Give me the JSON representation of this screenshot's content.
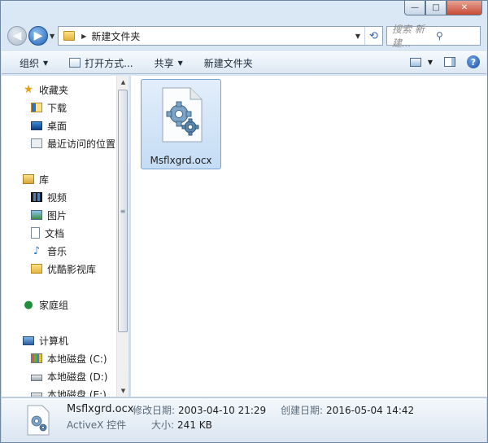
{
  "window": {
    "caption_buttons": {
      "minimize": "—",
      "maximize": "□",
      "close": "✕"
    }
  },
  "address": {
    "path": "新建文件夹",
    "search_placeholder": "搜索 新建..."
  },
  "toolbar": {
    "organize": "组织",
    "open_with": "打开方式...",
    "share": "共享",
    "new_folder": "新建文件夹"
  },
  "nav": {
    "favorites": "收藏夹",
    "downloads": "下载",
    "desktop": "桌面",
    "recent": "最近访问的位置",
    "libraries": "库",
    "videos": "视频",
    "pictures": "图片",
    "documents": "文档",
    "music": "音乐",
    "youku": "优酷影视库",
    "homegroup": "家庭组",
    "computer": "计算机",
    "drive_c": "本地磁盘 (C:)",
    "drive_d": "本地磁盘 (D:)",
    "drive_e": "本地磁盘 (E:)"
  },
  "file": {
    "name": "Msflxgrd.ocx"
  },
  "details": {
    "name": "Msflxgrd.ocx",
    "type": "ActiveX 控件",
    "modified_label": "修改日期:",
    "modified_value": "2003-04-10 21:29",
    "created_label": "创建日期:",
    "created_value": "2016-05-04 14:42",
    "size_label": "大小:",
    "size_value": "241 KB"
  },
  "icons": {
    "back": "arrow-left-icon",
    "forward": "arrow-right-icon",
    "refresh": "refresh-icon",
    "search": "magnifier-icon",
    "help": "help-icon",
    "file": "gear-document-icon"
  }
}
